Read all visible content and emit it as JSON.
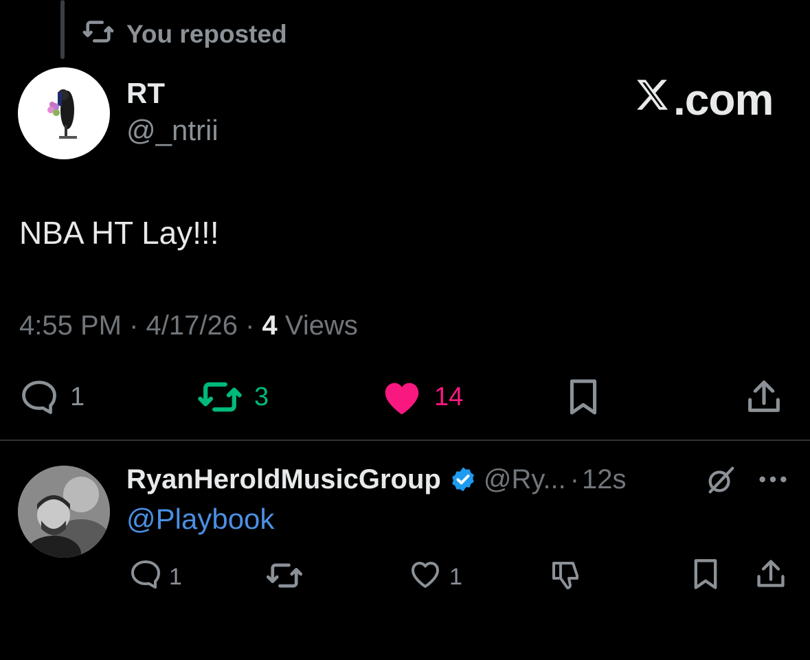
{
  "repost_banner": {
    "label": "You reposted"
  },
  "brand": {
    "label": ".com"
  },
  "main_post": {
    "display_name": "RT",
    "handle": "@_ntrii",
    "text": "NBA HT Lay!!!",
    "time": "4:55 PM",
    "separator": " · ",
    "date": "4/17/26",
    "views_count": "4",
    "views_label": " Views",
    "stats": {
      "replies": "1",
      "reposts": "3",
      "likes": "14"
    }
  },
  "reply_post": {
    "display_name": "RyanHeroldMusicGroup",
    "handle": "@Ry...",
    "separator": "·",
    "time": "12s",
    "text": "@Playbook",
    "stats": {
      "replies": "1",
      "likes": "1"
    }
  },
  "colors": {
    "background": "#000000",
    "text_primary": "#e7e9ea",
    "text_secondary": "#71767b",
    "repost_green": "#00ba7c",
    "like_pink": "#f91880",
    "link_blue": "#4a90e2",
    "verified_blue": "#1d9bf0"
  },
  "icons": [
    "repost-icon",
    "x-logo-icon",
    "reply-icon",
    "like-icon",
    "bookmark-icon",
    "share-icon",
    "verified-badge-icon",
    "grok-icon",
    "more-icon",
    "dislike-icon"
  ]
}
